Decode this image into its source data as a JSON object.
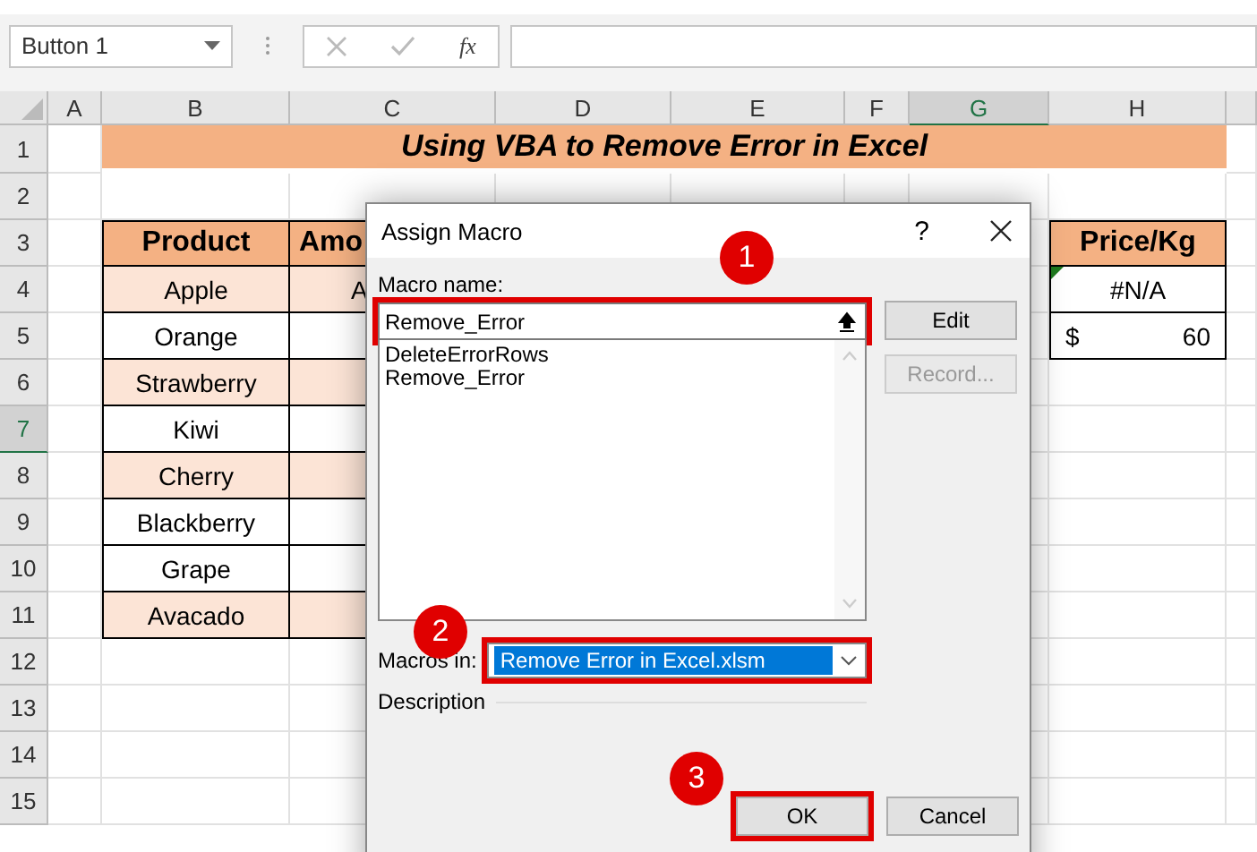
{
  "name_box": "Button 1",
  "formula_bar": {
    "function_label": "fx"
  },
  "columns": [
    {
      "label": "A",
      "selected": false
    },
    {
      "label": "B",
      "selected": false
    },
    {
      "label": "C",
      "selected": false
    },
    {
      "label": "D",
      "selected": false
    },
    {
      "label": "E",
      "selected": false
    },
    {
      "label": "F",
      "selected": false
    },
    {
      "label": "G",
      "selected": true
    },
    {
      "label": "H",
      "selected": false
    }
  ],
  "rows": [
    {
      "label": "1",
      "selected": false
    },
    {
      "label": "2",
      "selected": false
    },
    {
      "label": "3",
      "selected": false
    },
    {
      "label": "4",
      "selected": false
    },
    {
      "label": "5",
      "selected": false
    },
    {
      "label": "6",
      "selected": false
    },
    {
      "label": "7",
      "selected": true
    },
    {
      "label": "8",
      "selected": false
    },
    {
      "label": "9",
      "selected": false
    },
    {
      "label": "10",
      "selected": false
    },
    {
      "label": "11",
      "selected": false
    },
    {
      "label": "12",
      "selected": false
    },
    {
      "label": "13",
      "selected": false
    },
    {
      "label": "14",
      "selected": false
    },
    {
      "label": "15",
      "selected": false
    }
  ],
  "title": "Using VBA to Remove Error in Excel",
  "product_table": {
    "headers": [
      "Product",
      "Amo"
    ],
    "rows": [
      {
        "product": "Apple",
        "amount": "A",
        "highlighted": true
      },
      {
        "product": "Orange",
        "amount": "",
        "highlighted": false
      },
      {
        "product": "Strawberry",
        "amount": "",
        "highlighted": true
      },
      {
        "product": "Kiwi",
        "amount": "",
        "highlighted": false
      },
      {
        "product": "Cherry",
        "amount": "",
        "highlighted": true
      },
      {
        "product": "Blackberry",
        "amount": "",
        "highlighted": false
      },
      {
        "product": "Grape",
        "amount": "",
        "highlighted": false
      },
      {
        "product": "Avacado",
        "amount": "",
        "highlighted": true
      }
    ]
  },
  "price_table": {
    "header": "Price/Kg",
    "rows": [
      {
        "kind": "error",
        "currency": "",
        "value": "#N/A"
      },
      {
        "kind": "currency",
        "currency": "$",
        "value": "60"
      }
    ]
  },
  "dialog": {
    "title": "Assign Macro",
    "help": "?",
    "macro_name_label": "Macro name:",
    "macro_name": "Remove_Error",
    "macro_name_highlighted": true,
    "macros": [
      "DeleteErrorRows",
      "Remove_Error"
    ],
    "side_buttons": [
      {
        "label": "Edit",
        "disabled": false
      },
      {
        "label": "Record...",
        "disabled": true
      }
    ],
    "macros_in_label": "Macros in:",
    "macros_in": "Remove Error in Excel.xlsm",
    "macros_in_highlighted": true,
    "description_label": "Description",
    "ok": {
      "label": "OK",
      "highlighted": true
    },
    "cancel": {
      "label": "Cancel",
      "highlighted": false
    },
    "steps": [
      "1",
      "2",
      "3"
    ]
  }
}
